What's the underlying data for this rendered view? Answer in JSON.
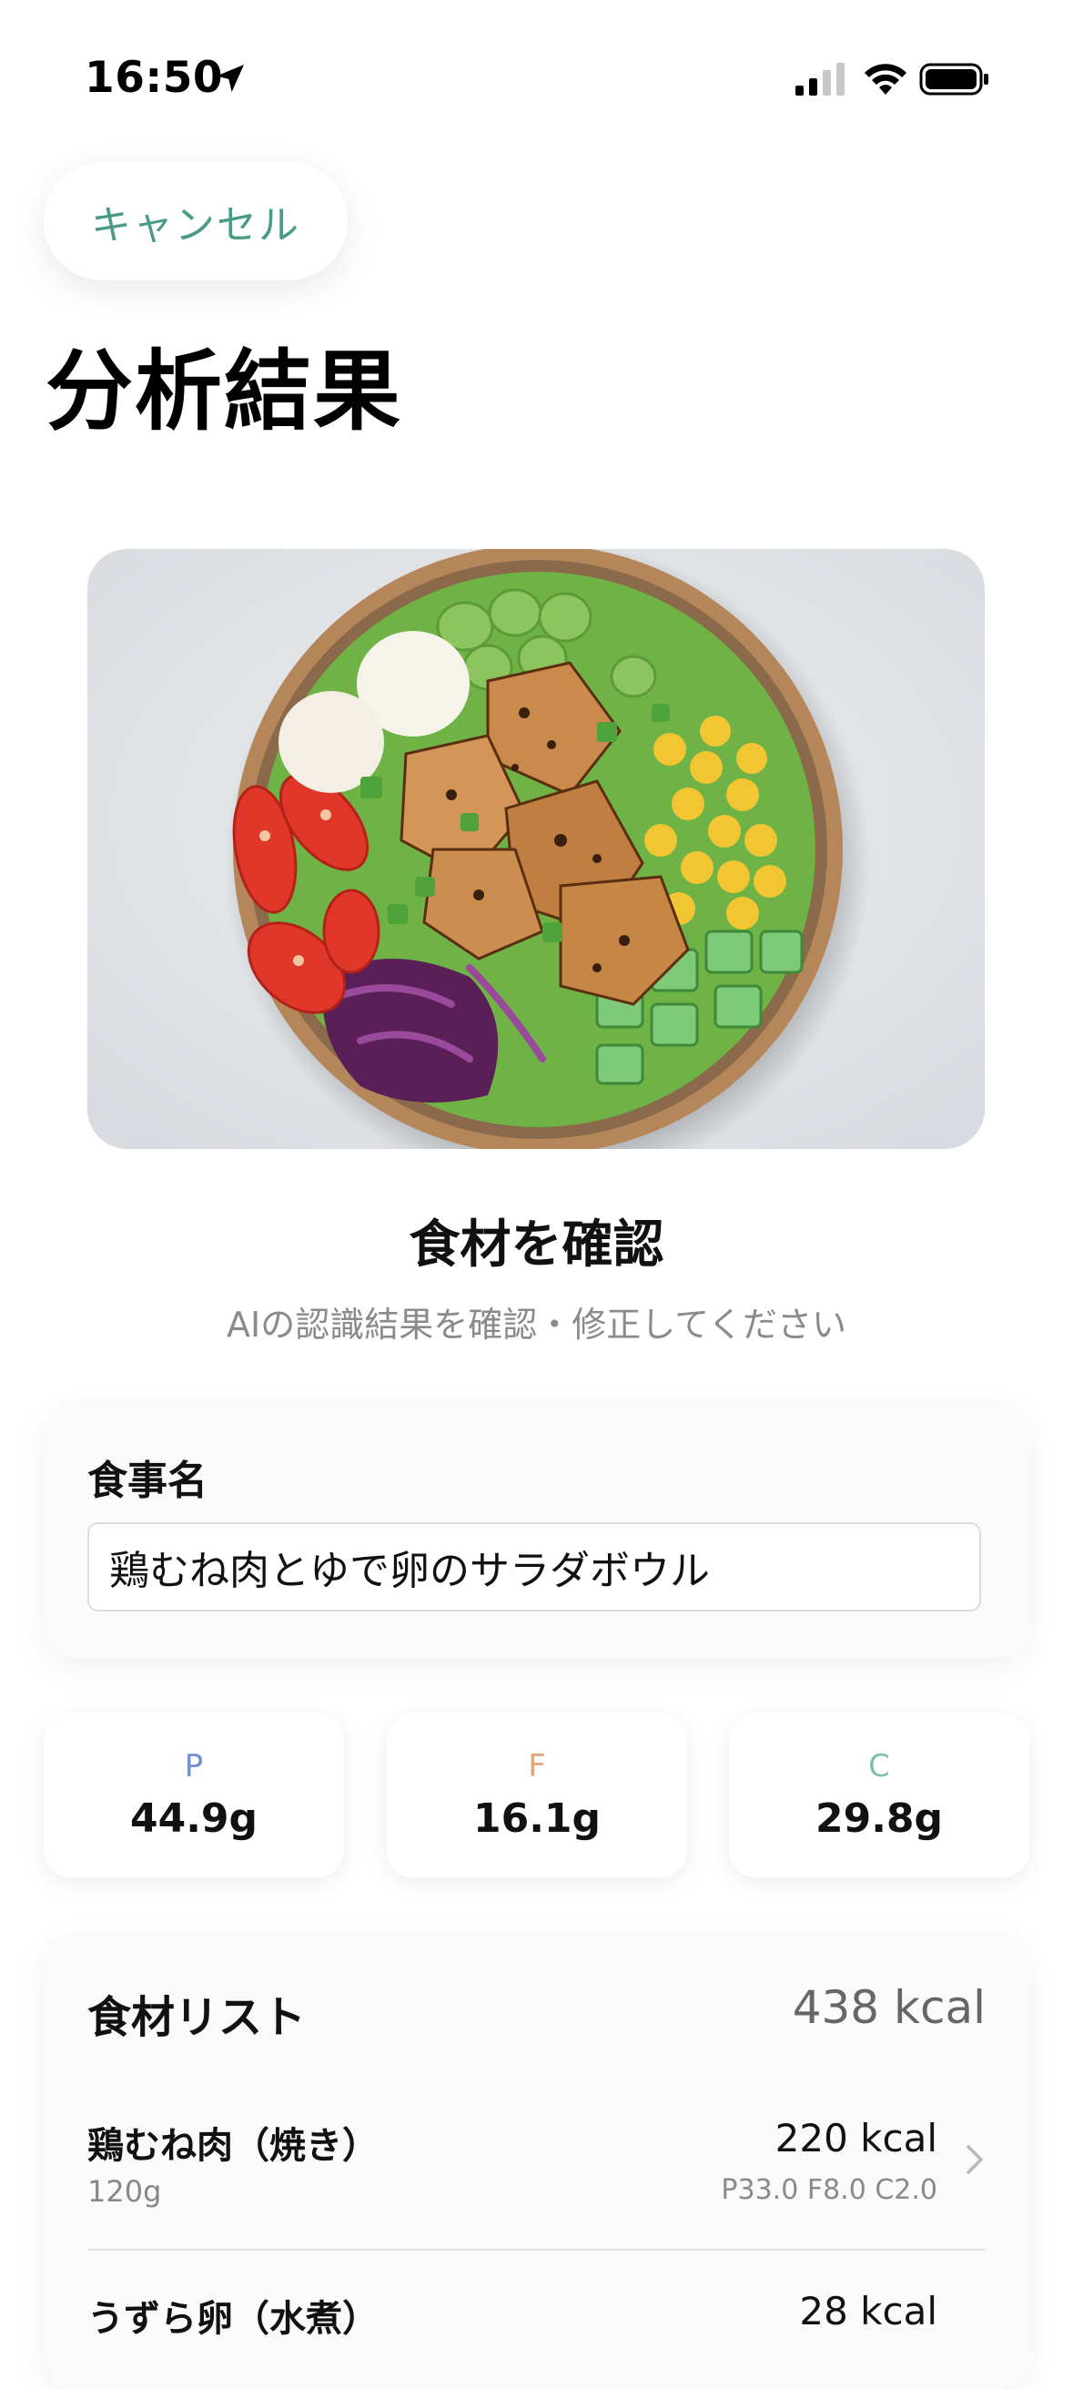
{
  "status_bar": {
    "time": "16:50"
  },
  "header": {
    "cancel_label": "キャンセル",
    "title": "分析結果"
  },
  "confirm": {
    "title": "食材を確認",
    "subtitle": "AIの認識結果を確認・修正してください"
  },
  "meal": {
    "label": "食事名",
    "value": "鶏むね肉とゆで卵のサラダボウル"
  },
  "macros": [
    {
      "letter": "P",
      "value": "44.9g",
      "color": "#6f8fd6"
    },
    {
      "letter": "F",
      "value": "16.1g",
      "color": "#e3a57b"
    },
    {
      "letter": "C",
      "value": "29.8g",
      "color": "#7cc4a3"
    }
  ],
  "ingredients": {
    "title": "食材リスト",
    "total": "438 kcal",
    "items": [
      {
        "name": "鶏むね肉（焼き）",
        "amount": "120g",
        "kcal": "220 kcal",
        "pfc": "P33.0 F8.0 C2.0"
      },
      {
        "name": "うずら卵（水煮）",
        "amount": "",
        "kcal": "28 kcal",
        "pfc": ""
      }
    ]
  },
  "colors": {
    "accent": "#4a9a88"
  }
}
